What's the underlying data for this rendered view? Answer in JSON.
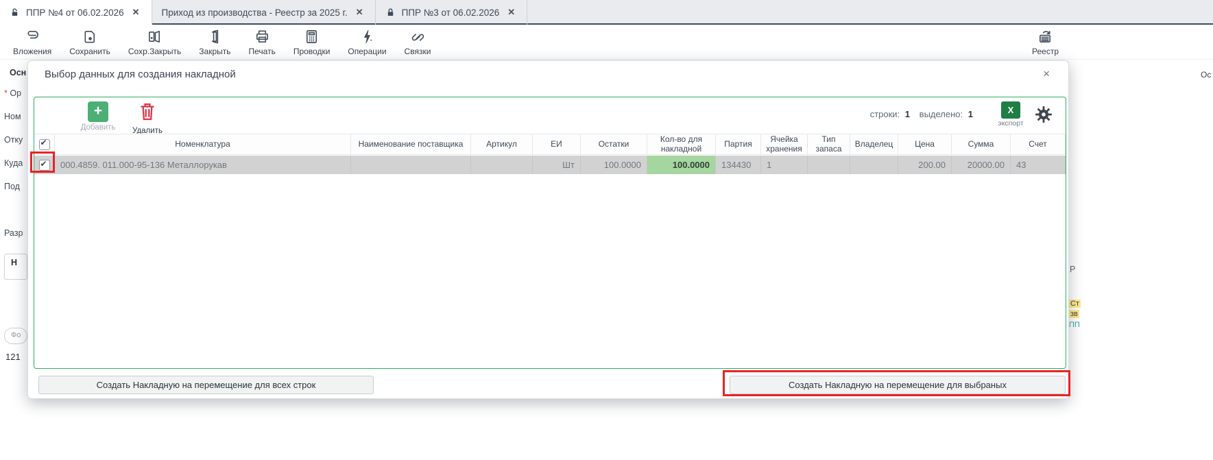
{
  "ui": {
    "close_glyph": "✕",
    "modal_close_glyph": "×"
  },
  "tabs": [
    {
      "title": "ППР №4 от 06.02.2026",
      "lock": "unlocked",
      "active": true
    },
    {
      "title": "Приход из производства - Реестр за 2025 г.",
      "lock": "none",
      "active": false
    },
    {
      "title": "ППР №3 от 06.02.2026",
      "lock": "locked",
      "active": false
    }
  ],
  "toolbar": {
    "items": [
      {
        "label": "Вложения",
        "icon": "paperclip-icon"
      },
      {
        "label": "Сохранить",
        "icon": "save-icon"
      },
      {
        "label": "Сохр.Закрыть",
        "icon": "save-close-icon"
      },
      {
        "label": "Закрыть",
        "icon": "door-icon"
      },
      {
        "label": "Печать",
        "icon": "printer-icon"
      },
      {
        "label": "Проводки",
        "icon": "calculator-icon"
      },
      {
        "label": "Операции",
        "icon": "lightning-icon"
      },
      {
        "label": "Связки",
        "icon": "link-icon"
      }
    ],
    "right_item": {
      "label": "Реестр",
      "icon": "registry-icon"
    },
    "edge_fragment": "Ос"
  },
  "background": {
    "left_labels": {
      "main_tab": "Осн",
      "org": "* Ор",
      "nom": "Ном",
      "from": "Отку",
      "to": "Куда",
      "sub": "Под",
      "razr": "Разр",
      "n_box": "Н",
      "filter": "Фо",
      "num": "121"
    },
    "right_fragments": {
      "r": "Р",
      "st": "Ст",
      "zv": "зв",
      "pp": "ПП"
    }
  },
  "modal": {
    "title": "Выбор данных для создания накладной",
    "toolbar": {
      "add_label": "Добавить",
      "delete_label": "Удалить",
      "rows_label": "строки:",
      "rows_value": "1",
      "selected_label": "выделено:",
      "selected_value": "1",
      "export_icon_text": "X",
      "export_label": "экспорт"
    },
    "table": {
      "columns": [
        "",
        "Номенклатура",
        "Наименование поставщика",
        "Артикул",
        "ЕИ",
        "Остатки",
        "Кол-во для накладной",
        "Партия",
        "Ячейка хранения",
        "Тип запаса",
        "Владелец",
        "Цена",
        "Сумма",
        "Счет"
      ],
      "rows": [
        {
          "checked": true,
          "nomenclature": "000.4859. 011.000-95-136 Металлорукав",
          "supplier": "",
          "article": "",
          "unit": "Шт",
          "balance": "100.0000",
          "qty_for_invoice": "100.0000",
          "batch": "134430",
          "storage_cell": "1",
          "stock_type": "",
          "owner": "",
          "price": "200.00",
          "sum": "20000.00",
          "account": "43"
        }
      ]
    },
    "buttons": {
      "all_rows": "Создать Накладную на перемещение для всех строк",
      "selected_rows": "Создать Накладную на перемещение для выбраных"
    }
  },
  "colors": {
    "accent_green_border": "#2fae60",
    "add_green": "#4caf75",
    "excel_green": "#1e7e45",
    "delete_red": "#d63a4e",
    "row_selected_gray": "#d2d2d2",
    "qty_cell_green": "#a6d6a0",
    "annotation_red": "#ea2227",
    "tab_strip": "#e9ebee",
    "tab_underline": "#3e4a5e"
  }
}
